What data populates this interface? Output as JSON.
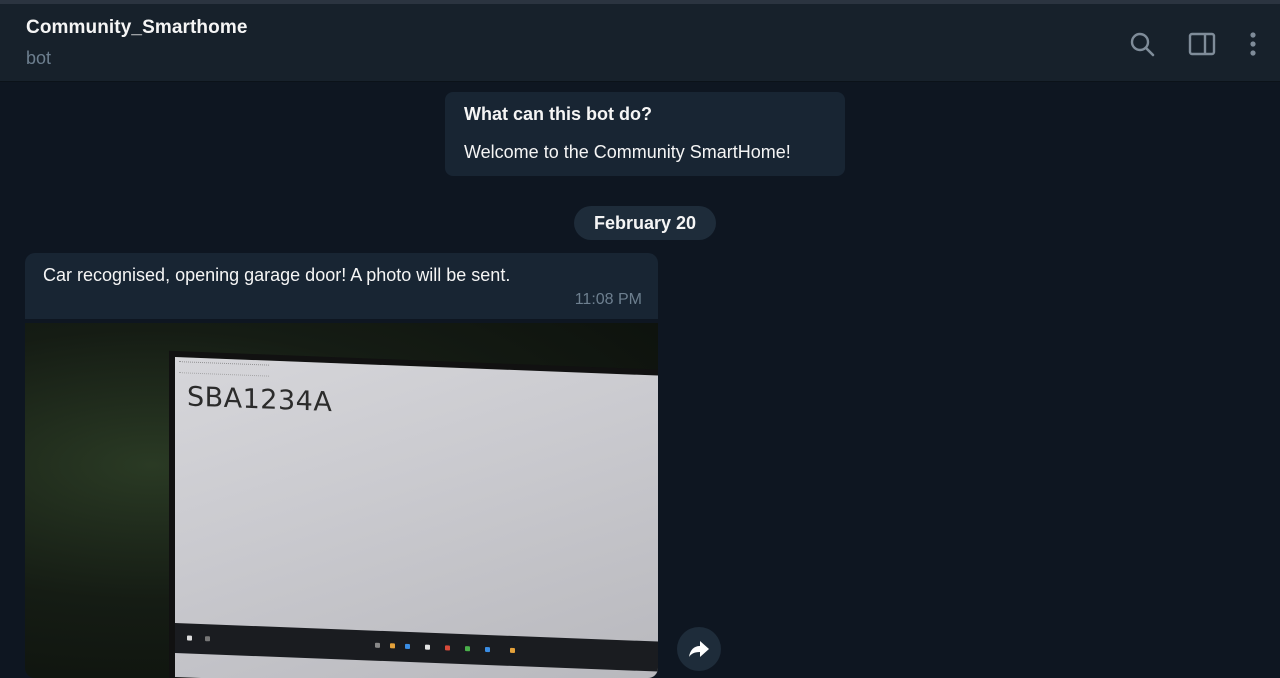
{
  "header": {
    "title": "Community_Smarthome",
    "subtitle": "bot",
    "icons": [
      "search-icon",
      "sidebar-toggle-icon",
      "more-vertical-icon"
    ]
  },
  "info_card": {
    "title": "What can this bot do?",
    "body": "Welcome to the Community SmartHome!"
  },
  "date_separator": "February 20",
  "message": {
    "text": "Car recognised, opening garage door! A photo will be sent.",
    "time": "11:08 PM"
  },
  "photo": {
    "visible_text": "SBA1234A"
  },
  "actions": {
    "forward_icon": "forward-arrow-icon"
  },
  "colors": {
    "background": "#0e1621",
    "header": "#17212b",
    "bubble": "#182533",
    "muted_text": "#6d7f8f",
    "text": "#f5f5f5"
  }
}
